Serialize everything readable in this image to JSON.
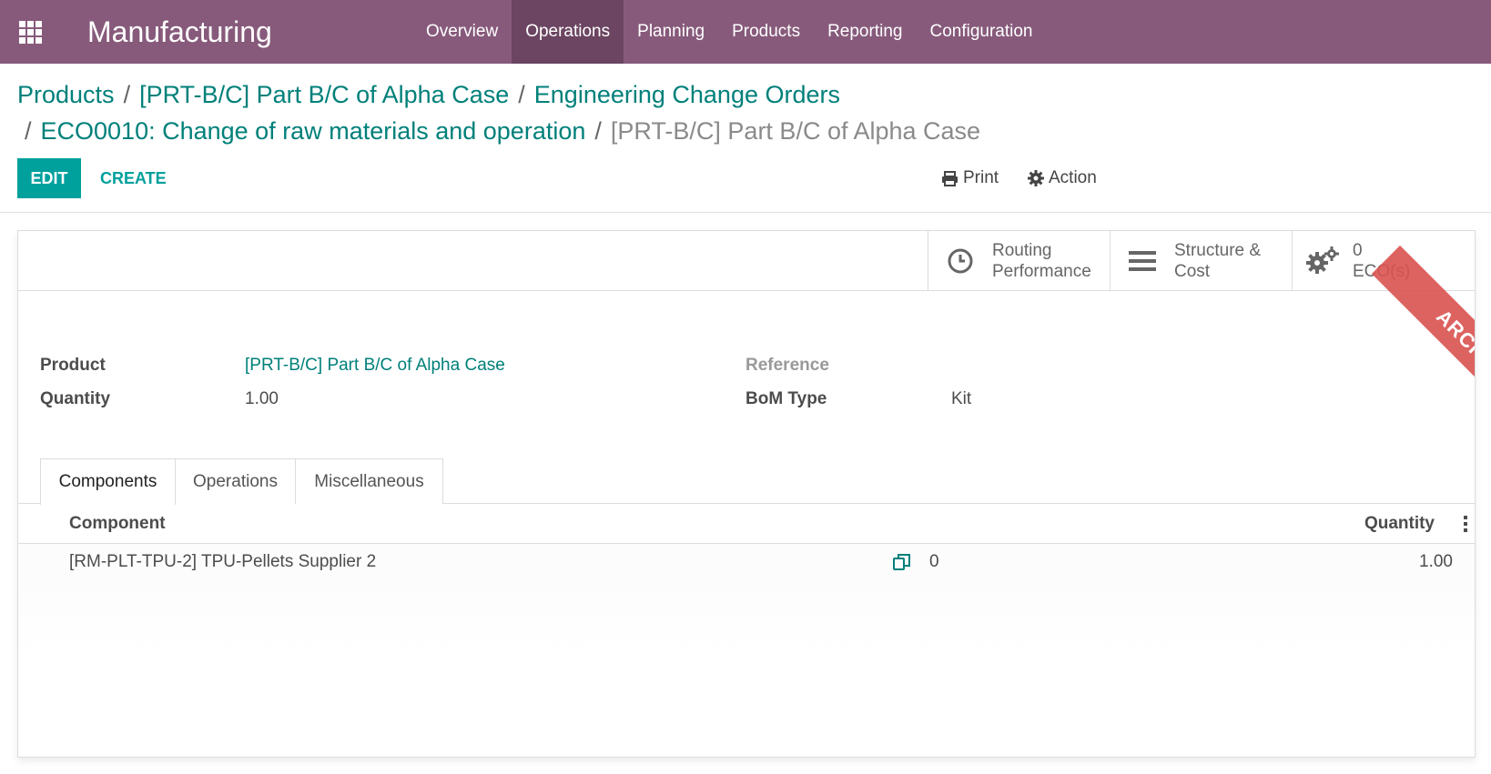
{
  "app": {
    "name": "Manufacturing",
    "menu": [
      "Overview",
      "Operations",
      "Planning",
      "Products",
      "Reporting",
      "Configuration"
    ],
    "active_menu": "Operations"
  },
  "breadcrumb": {
    "items": [
      "Products",
      "[PRT-B/C] Part B/C of Alpha Case",
      "Engineering Change Orders",
      "ECO0010: Change of raw materials and operation"
    ],
    "current": "[PRT-B/C] Part B/C of Alpha Case",
    "separator": "/"
  },
  "toolbar": {
    "edit_label": "EDIT",
    "create_label": "CREATE",
    "print_label": "Print",
    "action_label": "Action"
  },
  "smart_buttons": {
    "routing": {
      "line1": "Routing",
      "line2": "Performance",
      "icon": "clock-icon"
    },
    "structure": {
      "line1": "Structure &",
      "line2": "Cost",
      "icon": "bars-icon"
    },
    "eco": {
      "count": "0",
      "label": "ECO(s)",
      "icon": "cogs-icon"
    }
  },
  "ribbon": {
    "label": "ARCHIVED",
    "color": "#d9534f"
  },
  "form": {
    "product_label": "Product",
    "product_value": "[PRT-B/C] Part B/C of Alpha Case",
    "quantity_label": "Quantity",
    "quantity_value": "1.00",
    "reference_label": "Reference",
    "reference_value": "",
    "bom_type_label": "BoM Type",
    "bom_type_value": "Kit"
  },
  "tabs": [
    "Components",
    "Operations",
    "Miscellaneous"
  ],
  "active_tab": "Components",
  "components_table": {
    "headers": {
      "component": "Component",
      "quantity": "Quantity"
    },
    "rows": [
      {
        "component": "[RM-PLT-TPU-2] TPU-Pellets Supplier 2",
        "count": "0",
        "quantity": "1.00"
      }
    ]
  },
  "colors": {
    "navbar": "#875a7b",
    "navbar_active": "#6b4561",
    "primary": "#00a09d",
    "link": "#00807a",
    "ribbon": "#d9534f"
  }
}
